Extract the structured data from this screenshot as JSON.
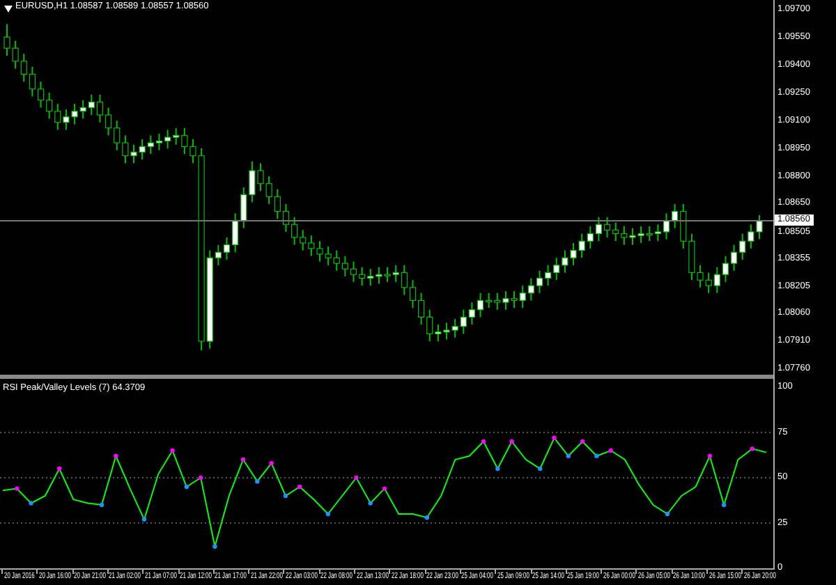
{
  "chart": {
    "title": "EURUSD,H1 1.08587 1.08589 1.08557 1.08560",
    "current_price": "1.08560",
    "chart_data": {
      "type": "candlestick",
      "ylim": [
        1.0776,
        1.0975
      ],
      "yticks": [
        {
          "value": 1.097,
          "label": "1.09700"
        },
        {
          "value": 1.0955,
          "label": "1.09550"
        },
        {
          "value": 1.094,
          "label": "1.09400"
        },
        {
          "value": 1.0925,
          "label": "1.09250"
        },
        {
          "value": 1.091,
          "label": "1.09100"
        },
        {
          "value": 1.0895,
          "label": "1.08950"
        },
        {
          "value": 1.088,
          "label": "1.08800"
        },
        {
          "value": 1.0865,
          "label": "1.08650"
        },
        {
          "value": 1.08505,
          "label": "1.08505"
        },
        {
          "value": 1.08355,
          "label": "1.08355"
        },
        {
          "value": 1.08205,
          "label": "1.08205"
        },
        {
          "value": 1.0806,
          "label": "1.08060"
        },
        {
          "value": 1.0791,
          "label": "1.07910"
        },
        {
          "value": 1.0776,
          "label": "1.07760"
        }
      ],
      "ohlc": [
        [
          1.0955,
          1.0962,
          1.0945,
          1.0949
        ],
        [
          1.0949,
          1.0953,
          1.0938,
          1.0942
        ],
        [
          1.0942,
          1.0946,
          1.0931,
          1.0935
        ],
        [
          1.0935,
          1.0939,
          1.0923,
          1.0927
        ],
        [
          1.0927,
          1.0931,
          1.0917,
          1.0921
        ],
        [
          1.0921,
          1.0925,
          1.0911,
          1.0915
        ],
        [
          1.0915,
          1.0919,
          1.0905,
          1.0909
        ],
        [
          1.0909,
          1.0916,
          1.0905,
          1.0912
        ],
        [
          1.0912,
          1.0919,
          1.0908,
          1.0915
        ],
        [
          1.0915,
          1.0921,
          1.0911,
          1.0917
        ],
        [
          1.0917,
          1.0924,
          1.0913,
          1.092
        ],
        [
          1.092,
          1.0924,
          1.0909,
          1.0913
        ],
        [
          1.0913,
          1.0917,
          1.0902,
          1.0906
        ],
        [
          1.0906,
          1.091,
          1.0894,
          1.0898
        ],
        [
          1.0898,
          1.0902,
          1.0887,
          1.0891
        ],
        [
          1.0891,
          1.0897,
          1.0887,
          1.0893
        ],
        [
          1.0893,
          1.09,
          1.0889,
          1.0896
        ],
        [
          1.0896,
          1.0902,
          1.0892,
          1.0898
        ],
        [
          1.0898,
          1.0903,
          1.0894,
          1.0899
        ],
        [
          1.0899,
          1.0905,
          1.0895,
          1.0901
        ],
        [
          1.0901,
          1.0906,
          1.0897,
          1.0902
        ],
        [
          1.0902,
          1.0906,
          1.0892,
          1.0896
        ],
        [
          1.0896,
          1.09,
          1.0887,
          1.0891
        ],
        [
          1.0891,
          1.0895,
          1.0786,
          1.0791
        ],
        [
          1.0791,
          1.084,
          1.0787,
          1.0836
        ],
        [
          1.0836,
          1.0843,
          1.0832,
          1.0839
        ],
        [
          1.0839,
          1.0847,
          1.0835,
          1.0843
        ],
        [
          1.0843,
          1.086,
          1.0839,
          1.0856
        ],
        [
          1.0856,
          1.0874,
          1.0852,
          1.087
        ],
        [
          1.087,
          1.0888,
          1.0866,
          1.0883
        ],
        [
          1.0883,
          1.0887,
          1.0872,
          1.0876
        ],
        [
          1.0876,
          1.088,
          1.0865,
          1.0869
        ],
        [
          1.0869,
          1.0873,
          1.0857,
          1.0861
        ],
        [
          1.0861,
          1.0865,
          1.085,
          1.0854
        ],
        [
          1.0854,
          1.0858,
          1.0843,
          1.0847
        ],
        [
          1.0847,
          1.0851,
          1.084,
          1.0844
        ],
        [
          1.0844,
          1.0848,
          1.0837,
          1.0841
        ],
        [
          1.0841,
          1.0845,
          1.0834,
          1.0838
        ],
        [
          1.0838,
          1.0842,
          1.0832,
          1.0836
        ],
        [
          1.0836,
          1.084,
          1.0829,
          1.0833
        ],
        [
          1.0833,
          1.0837,
          1.0826,
          1.083
        ],
        [
          1.083,
          1.0834,
          1.0823,
          1.0827
        ],
        [
          1.0827,
          1.0831,
          1.0821,
          1.0825
        ],
        [
          1.0825,
          1.083,
          1.0821,
          1.0826
        ],
        [
          1.0826,
          1.0831,
          1.0822,
          1.0827
        ],
        [
          1.0827,
          1.0831,
          1.0823,
          1.0827
        ],
        [
          1.0827,
          1.0832,
          1.0823,
          1.0828
        ],
        [
          1.0828,
          1.0832,
          1.0816,
          1.082
        ],
        [
          1.082,
          1.0824,
          1.0809,
          1.0813
        ],
        [
          1.0813,
          1.0817,
          1.08,
          1.0804
        ],
        [
          1.0804,
          1.0808,
          1.0791,
          1.0795
        ],
        [
          1.0795,
          1.08,
          1.0791,
          1.0796
        ],
        [
          1.0796,
          1.0801,
          1.0792,
          1.0797
        ],
        [
          1.0797,
          1.0803,
          1.0793,
          1.0799
        ],
        [
          1.0799,
          1.0808,
          1.0795,
          1.0804
        ],
        [
          1.0804,
          1.0812,
          1.08,
          1.0808
        ],
        [
          1.0808,
          1.0817,
          1.0804,
          1.0813
        ],
        [
          1.0813,
          1.0817,
          1.0809,
          1.0813
        ],
        [
          1.0813,
          1.0817,
          1.0808,
          1.0812
        ],
        [
          1.0812,
          1.0818,
          1.0808,
          1.0814
        ],
        [
          1.0814,
          1.0818,
          1.0809,
          1.0813
        ],
        [
          1.0813,
          1.0821,
          1.0809,
          1.0817
        ],
        [
          1.0817,
          1.0825,
          1.0813,
          1.0821
        ],
        [
          1.0821,
          1.0829,
          1.0817,
          1.0825
        ],
        [
          1.0825,
          1.0832,
          1.0821,
          1.0828
        ],
        [
          1.0828,
          1.0836,
          1.0824,
          1.0832
        ],
        [
          1.0832,
          1.084,
          1.0828,
          1.0836
        ],
        [
          1.0836,
          1.0844,
          1.0832,
          1.084
        ],
        [
          1.084,
          1.0849,
          1.0836,
          1.0845
        ],
        [
          1.0845,
          1.0853,
          1.0841,
          1.0849
        ],
        [
          1.0849,
          1.0858,
          1.0845,
          1.0854
        ],
        [
          1.0854,
          1.0858,
          1.0847,
          1.0851
        ],
        [
          1.0851,
          1.0855,
          1.0845,
          1.0849
        ],
        [
          1.0849,
          1.0853,
          1.0843,
          1.0847
        ],
        [
          1.0847,
          1.0852,
          1.0843,
          1.0848
        ],
        [
          1.0848,
          1.0853,
          1.0844,
          1.0849
        ],
        [
          1.0849,
          1.0853,
          1.0845,
          1.0849
        ],
        [
          1.0849,
          1.0854,
          1.0845,
          1.085
        ],
        [
          1.085,
          1.086,
          1.0846,
          1.0856
        ],
        [
          1.0856,
          1.0865,
          1.0852,
          1.0861
        ],
        [
          1.0861,
          1.0865,
          1.0841,
          1.0845
        ],
        [
          1.0845,
          1.0849,
          1.0824,
          1.0828
        ],
        [
          1.0828,
          1.0832,
          1.082,
          1.0824
        ],
        [
          1.0824,
          1.0828,
          1.0817,
          1.0821
        ],
        [
          1.0821,
          1.0831,
          1.0817,
          1.0827
        ],
        [
          1.0827,
          1.0837,
          1.0823,
          1.0833
        ],
        [
          1.0833,
          1.0843,
          1.0829,
          1.0839
        ],
        [
          1.0839,
          1.0849,
          1.0835,
          1.0845
        ],
        [
          1.0845,
          1.0854,
          1.0841,
          1.085
        ],
        [
          1.085,
          1.0859,
          1.0846,
          1.0856
        ]
      ]
    }
  },
  "indicator": {
    "title": "RSI Peak/Valley Levels (7) 64.3709",
    "chart_data": {
      "type": "line",
      "ylim": [
        0,
        100
      ],
      "grid": true,
      "yticks": [
        {
          "value": 100,
          "label": "100"
        },
        {
          "value": 75,
          "label": "75"
        },
        {
          "value": 50,
          "label": "50"
        },
        {
          "value": 25,
          "label": "25"
        },
        {
          "value": 0,
          "label": "0"
        }
      ],
      "series": [
        {
          "color": "#00ff00",
          "values": [
            43,
            44,
            36,
            40,
            55,
            38,
            36,
            35,
            62,
            44,
            27,
            52,
            65,
            45,
            50,
            12,
            40,
            60,
            48,
            58,
            40,
            45,
            38,
            30,
            40,
            50,
            36,
            44,
            30,
            30,
            28,
            40,
            60,
            62,
            70,
            55,
            70,
            60,
            55,
            72,
            62,
            70,
            62,
            65,
            60,
            46,
            35,
            30,
            40,
            45,
            62,
            35,
            60,
            66,
            64
          ]
        }
      ]
    }
  },
  "time_axis": [
    "20 Jan 2016",
    "20 Jan 16:00",
    "20 Jan 21:00",
    "21 Jan 02:00",
    "21 Jan 07:00",
    "21 Jan 12:00",
    "21 Jan 17:00",
    "21 Jan 22:00",
    "22 Jan 03:00",
    "22 Jan 08:00",
    "22 Jan 13:00",
    "22 Jan 18:00",
    "22 Jan 23:00",
    "25 Jan 04:00",
    "25 Jan 09:00",
    "25 Jan 14:00",
    "25 Jan 19:00",
    "26 Jan 00:00",
    "26 Jan 05:00",
    "26 Jan 10:00",
    "26 Jan 15:00",
    "26 Jan 20:00"
  ]
}
